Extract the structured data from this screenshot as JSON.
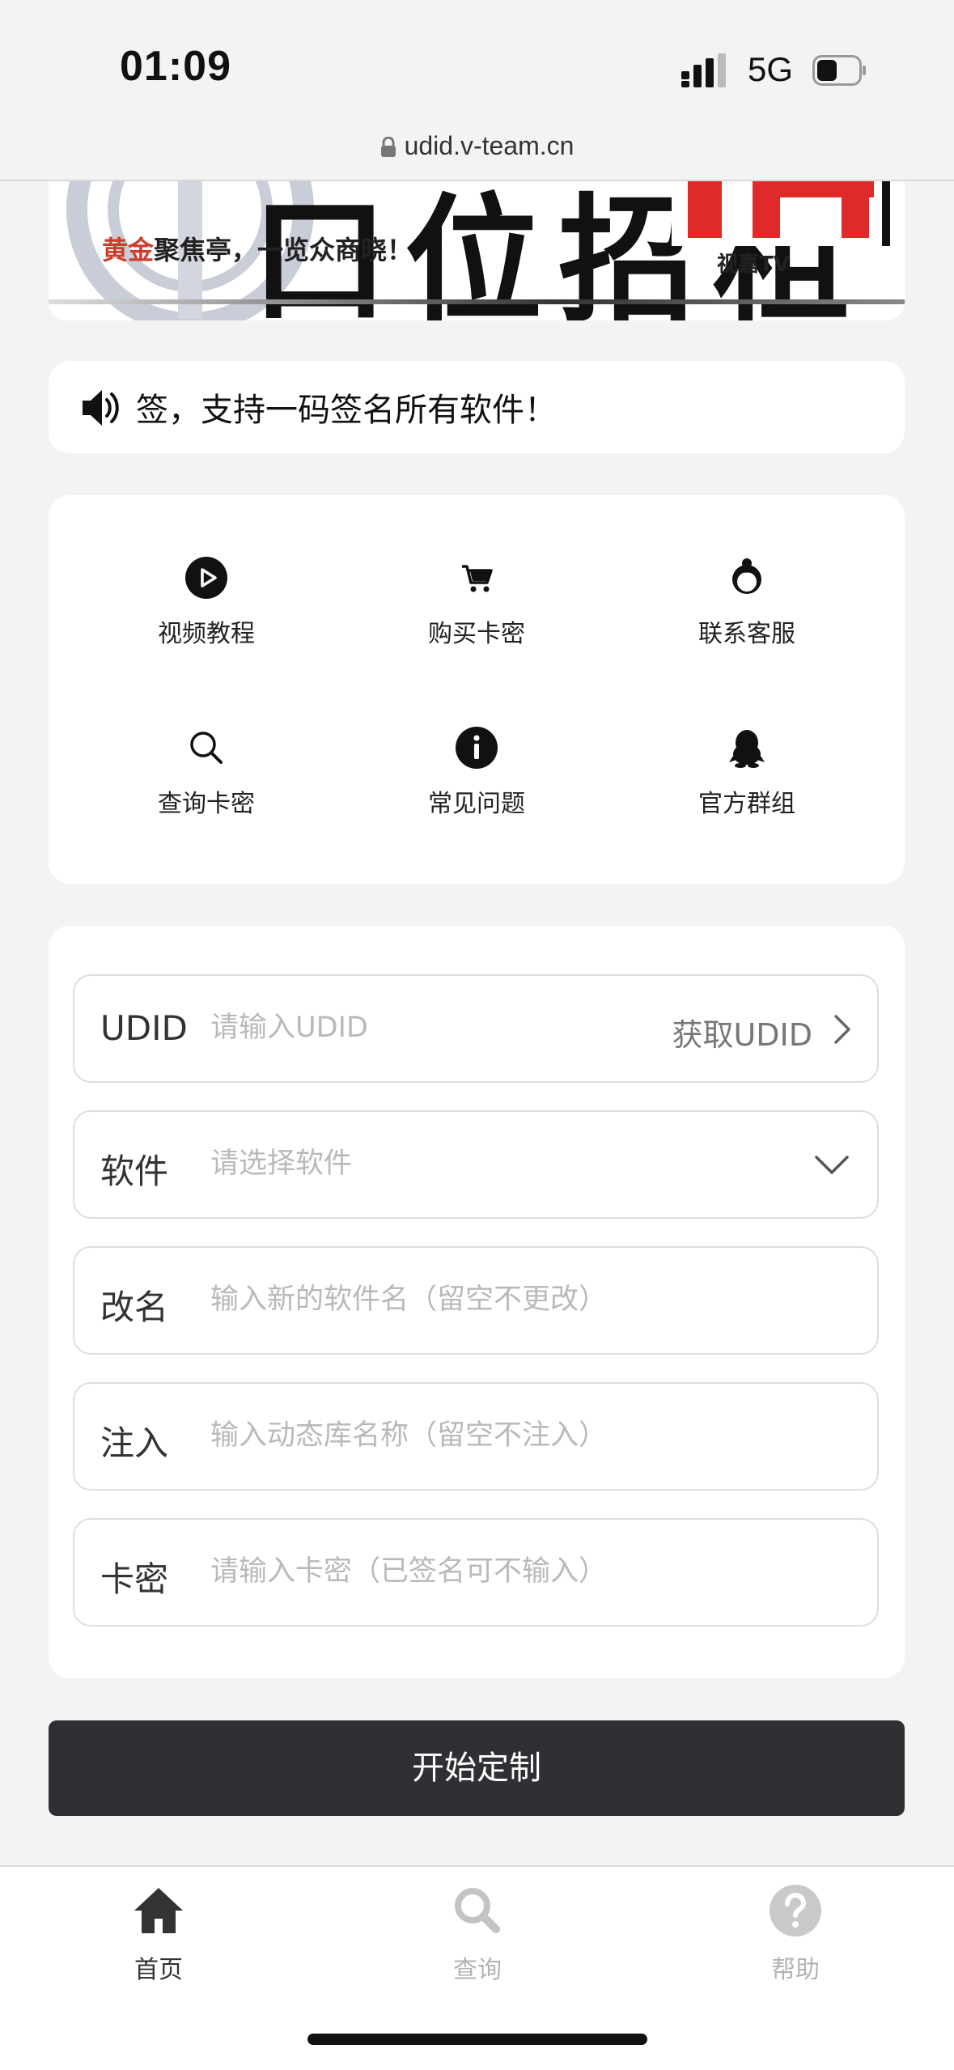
{
  "status": {
    "time": "01:09",
    "network": "5G"
  },
  "browser": {
    "url": "udid.v-team.cn"
  },
  "banner": {
    "headline": "口位招租",
    "sub_gold": "黄金",
    "sub_rest": "聚焦亭，一览众商晓！",
    "logo": "视嘉TV"
  },
  "notice": {
    "text": "签，支持一码签名所有软件！"
  },
  "menu": {
    "items": [
      {
        "label": "视频教程",
        "icon": "play-circle-icon"
      },
      {
        "label": "购买卡密",
        "icon": "cart-icon"
      },
      {
        "label": "联系客服",
        "icon": "support-agent-icon"
      },
      {
        "label": "查询卡密",
        "icon": "search-icon"
      },
      {
        "label": "常见问题",
        "icon": "info-icon"
      },
      {
        "label": "官方群组",
        "icon": "qq-penguin-icon"
      }
    ]
  },
  "form": {
    "udid": {
      "label": "UDID",
      "placeholder": "请输入UDID",
      "action": "获取UDID"
    },
    "software": {
      "label": "软件",
      "placeholder": "请选择软件"
    },
    "rename": {
      "label": "改名",
      "placeholder": "输入新的软件名（留空不更改）"
    },
    "inject": {
      "label": "注入",
      "placeholder": "输入动态库名称（留空不注入）"
    },
    "card": {
      "label": "卡密",
      "placeholder": "请输入卡密（已签名可不输入）"
    }
  },
  "submit": {
    "label": "开始定制"
  },
  "tabs": [
    {
      "label": "首页",
      "icon": "home-icon",
      "active": true
    },
    {
      "label": "查询",
      "icon": "search-icon",
      "active": false
    },
    {
      "label": "帮助",
      "icon": "help-icon",
      "active": false
    }
  ]
}
